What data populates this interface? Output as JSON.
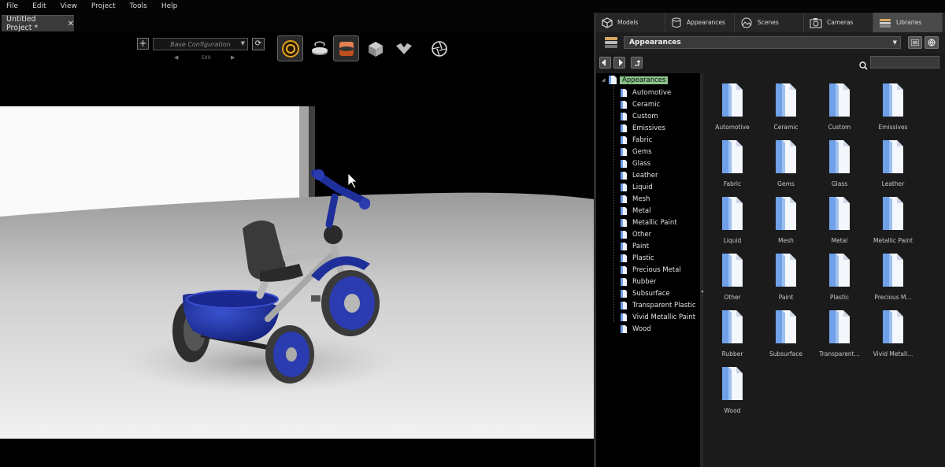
{
  "menu": [
    "File",
    "Edit",
    "View",
    "Project",
    "Tools",
    "Help"
  ],
  "document_tab": {
    "title": "Untitled Project *",
    "close": "✕"
  },
  "config": {
    "add": "+",
    "selected": "Base Configuration",
    "refresh": "⟳",
    "prev": "◀",
    "edit": "Edit",
    "next": "▶"
  },
  "panel_tabs": [
    {
      "label": "Models",
      "icon": "cube-icon"
    },
    {
      "label": "Appearances",
      "icon": "cylinder-icon"
    },
    {
      "label": "Scenes",
      "icon": "landscape-icon"
    },
    {
      "label": "Cameras",
      "icon": "camera-icon"
    },
    {
      "label": "Libraries",
      "icon": "books-icon",
      "active": true
    }
  ],
  "library": {
    "selected": "Appearances",
    "search_value": ""
  },
  "tree": {
    "root": "Appearances",
    "items": [
      "Automotive",
      "Ceramic",
      "Custom",
      "Emissives",
      "Fabric",
      "Gems",
      "Glass",
      "Leather",
      "Liquid",
      "Mesh",
      "Metal",
      "Metallic Paint",
      "Other",
      "Paint",
      "Plastic",
      "Precious Metal",
      "Rubber",
      "Subsurface",
      "Transparent Plastic",
      "Vivid Metallic Paint",
      "Wood"
    ]
  },
  "grid": [
    "Automotive",
    "Ceramic",
    "Custom",
    "Emissives",
    "Fabric",
    "Gems",
    "Glass",
    "Leather",
    "Liquid",
    "Mesh",
    "Metal",
    "Metallic Paint",
    "Other",
    "Paint",
    "Plastic",
    "Precious M...",
    "Rubber",
    "Subsurface",
    "Transparent...",
    "Vivid Metall...",
    "Wood"
  ],
  "colors": {
    "tree_root_highlight": "#8bc38b",
    "active_tab": "#4a4a4a",
    "panel_bg": "#1b1b1b",
    "trike_blue": "#1f2f9a",
    "folder_blue": "#6fa0e8"
  }
}
